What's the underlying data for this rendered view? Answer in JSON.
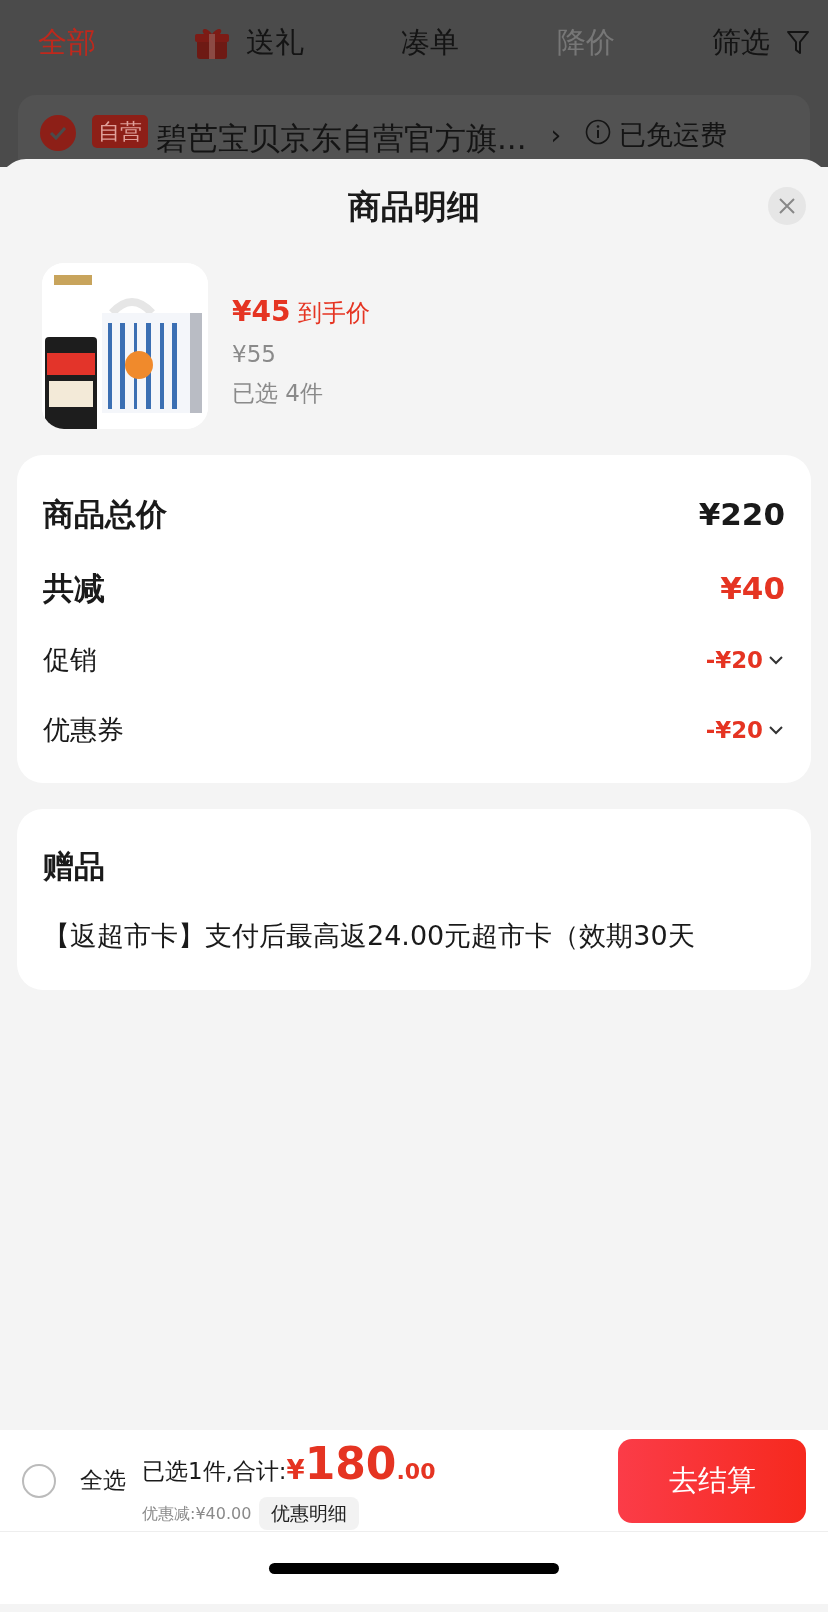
{
  "tabs": [
    {
      "label": "全部",
      "selected": true,
      "disabled": false,
      "kind": "text"
    },
    {
      "label": "送礼",
      "selected": false,
      "disabled": false,
      "kind": "gift"
    },
    {
      "label": "凑单",
      "selected": false,
      "disabled": false,
      "kind": "text"
    },
    {
      "label": "降价",
      "selected": false,
      "disabled": true,
      "kind": "text"
    }
  ],
  "filter": {
    "label": "筛选"
  },
  "shop": {
    "checked": true,
    "badge": "自营",
    "name": "碧芭宝贝京东自营官方旗...",
    "chevron": "›",
    "shipping": "已免运费"
  },
  "sheet": {
    "title": "商品明细",
    "product": {
      "kind": "picture",
      "price": "¥45",
      "price_label": "到手价",
      "original_price": "¥55",
      "quantity": "已选 4件"
    },
    "summary": [
      {
        "label": "商品总价",
        "value": "¥220",
        "kind": "total"
      },
      {
        "label": "共减",
        "value": "¥40",
        "kind": "discount"
      },
      {
        "label": "促销",
        "value": "-¥20",
        "kind": "detail"
      },
      {
        "label": "优惠券",
        "value": "-¥20",
        "kind": "detail"
      }
    ],
    "gift": {
      "title": "赠品",
      "text": "【返超市卡】支付后最高返24.00元超市卡（效期30天"
    }
  },
  "footer": {
    "select_all": {
      "label": "全选",
      "checked": false
    },
    "selected_text": "已选1件,合计:",
    "currency": "¥",
    "amount": "180",
    "decimals": ".00",
    "discount": "优惠减:¥40.00",
    "detail_button": "优惠明细",
    "checkout": "去结算"
  }
}
